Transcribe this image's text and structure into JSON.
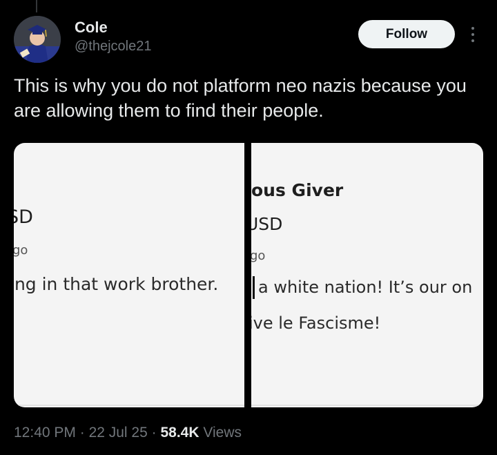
{
  "author": {
    "name": "Cole",
    "handle": "@thejcole21"
  },
  "actions": {
    "follow_label": "Follow",
    "more_icon": "more-vertical-icon"
  },
  "tweet": {
    "text": "This is why you do not platform neo nazis because you are allowing them to find their people."
  },
  "media": {
    "left_panel": {
      "currency": "JSD",
      "time_ago": "go",
      "message": "ing in that work brother."
    },
    "right_panel": {
      "title": "ous Giver",
      "currency": "USD",
      "time_ago": "go",
      "message_line1": "a white nation! It’s our on",
      "message_line2": "ive le Fascisme!"
    }
  },
  "meta": {
    "time": "12:40 PM",
    "separator": " · ",
    "date": "22 Jul 25",
    "views_count": "58.4K",
    "views_label": " Views"
  }
}
